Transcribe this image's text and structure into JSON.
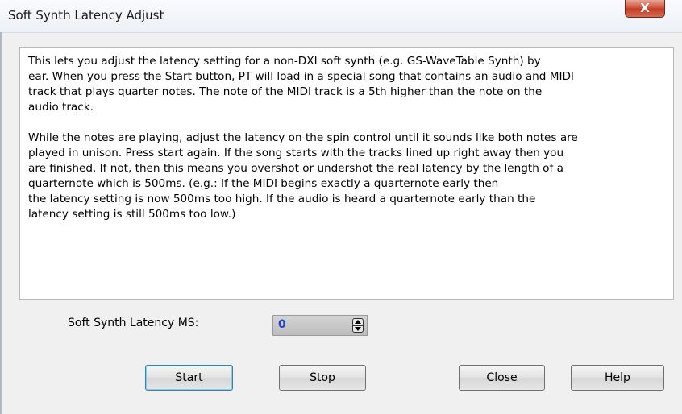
{
  "window": {
    "title": "Soft Synth Latency Adjust",
    "close_glyph": "X"
  },
  "description": {
    "paragraph1": "This lets you adjust the latency setting for a non-DXI soft synth (e.g.  GS-WaveTable Synth) by\near. When you press the Start button, PT will load in a special song that contains an audio and MIDI\ntrack that plays quarter notes. The note of the MIDI track is a 5th higher than the note on the\naudio track.",
    "paragraph2": "While the notes are playing, adjust the latency on the spin control until it sounds like both notes are\nplayed in unison. Press start again. If the song starts with the tracks lined up right away  then you\nare finished.  If not, then this means you overshot or undershot the real latency  by the length of a\nquarternote which is 500ms.  (e.g.: If the MIDI begins exactly  a quarternote early then\nthe latency setting is now 500ms too high.  If the audio is heard a quarternote early than the\nlatency setting is still 500ms too low.)"
  },
  "latency": {
    "label": "Soft Synth Latency MS:",
    "value": "0",
    "value_color": "#1f3fd0"
  },
  "buttons": {
    "start": "Start",
    "stop": "Stop",
    "close": "Close",
    "help": "Help"
  },
  "icons": {
    "close": "close-icon",
    "spin_up": "spin-up-icon",
    "spin_down": "spin-down-icon"
  }
}
